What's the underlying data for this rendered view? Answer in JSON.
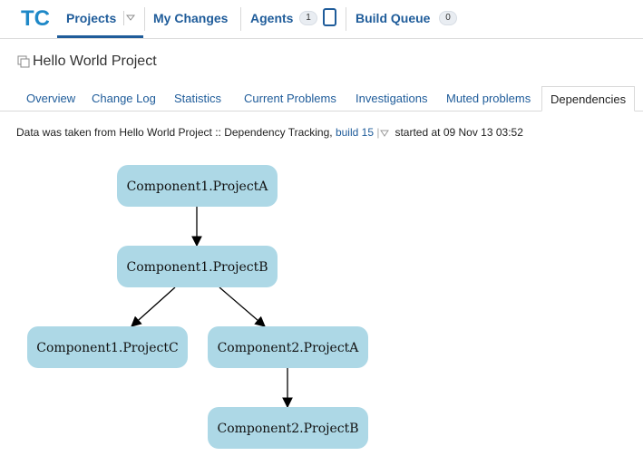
{
  "nav": {
    "logo_text": "TC",
    "projects": "Projects",
    "my_changes": "My Changes",
    "agents": "Agents",
    "agents_count": "1",
    "build_queue": "Build Queue",
    "build_queue_count": "0"
  },
  "page": {
    "title": "Hello World Project"
  },
  "tabs": [
    {
      "label": "Overview"
    },
    {
      "label": "Change Log"
    },
    {
      "label": "Statistics"
    },
    {
      "label": "Current Problems"
    },
    {
      "label": "Investigations"
    },
    {
      "label": "Muted problems"
    },
    {
      "label": "Dependencies",
      "active": true
    }
  ],
  "info": {
    "prefix": "Data was taken from Hello World Project :: Dependency Tracking,",
    "build_link": "build 15",
    "started": "started at 09 Nov 13 03:52"
  },
  "graph": {
    "node_color": "#add8e6",
    "nodes": [
      {
        "id": "c1a",
        "label": "Component1.ProjectA"
      },
      {
        "id": "c1b",
        "label": "Component1.ProjectB"
      },
      {
        "id": "c1c",
        "label": "Component1.ProjectC"
      },
      {
        "id": "c2a",
        "label": "Component2.ProjectA"
      },
      {
        "id": "c2b",
        "label": "Component2.ProjectB"
      }
    ],
    "edges": [
      {
        "from": "c1a",
        "to": "c1b"
      },
      {
        "from": "c1b",
        "to": "c1c"
      },
      {
        "from": "c1b",
        "to": "c2a"
      },
      {
        "from": "c2a",
        "to": "c2b"
      }
    ]
  }
}
